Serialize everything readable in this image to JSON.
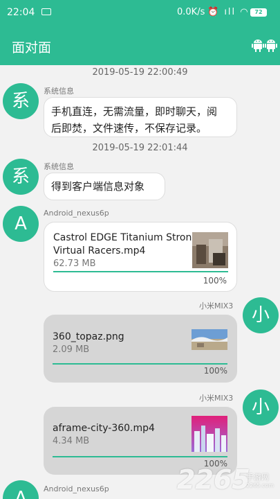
{
  "status_bar": {
    "time": "22:04",
    "net_speed": "0.0K/s",
    "icons": "⏰ ıll ◠",
    "battery": "72"
  },
  "app_bar": {
    "title": "面对面",
    "action_icon": "android-icon"
  },
  "messages": {
    "ts1": "2019-05-19 22:00:49",
    "sys1": {
      "avatar": "系",
      "sender": "系统信息",
      "text_line1": "手机直连，无需流量，即时聊天，阅",
      "text_line2": "后即焚，文件速传，不保存记录。"
    },
    "ts2": "2019-05-19 22:01:44",
    "sys2": {
      "avatar": "系",
      "sender": "系统信息",
      "text": "得到客户端信息对象"
    },
    "file1": {
      "avatar": "A",
      "sender": "Android_nexus6p",
      "name_line1": "Castrol EDGE Titanium Strong",
      "name_line2": "Virtual Racers.mp4",
      "size": "62.73 MB",
      "progress": "100%"
    },
    "file2": {
      "avatar": "小",
      "sender": "小米MIX3",
      "name": "360_topaz.png",
      "size": "2.09 MB",
      "progress": "100%"
    },
    "file3": {
      "avatar": "小",
      "sender": "小米MIX3",
      "name": "aframe-city-360.mp4",
      "size": "4.34 MB",
      "progress": "100%"
    },
    "file4": {
      "avatar": "A",
      "sender": "Android_nexus6p"
    }
  },
  "watermark": {
    "number": "2265",
    "unit": ".com",
    "cn": "手游网",
    "url": "2265.com"
  },
  "colors": {
    "accent": "#2dbb93"
  }
}
